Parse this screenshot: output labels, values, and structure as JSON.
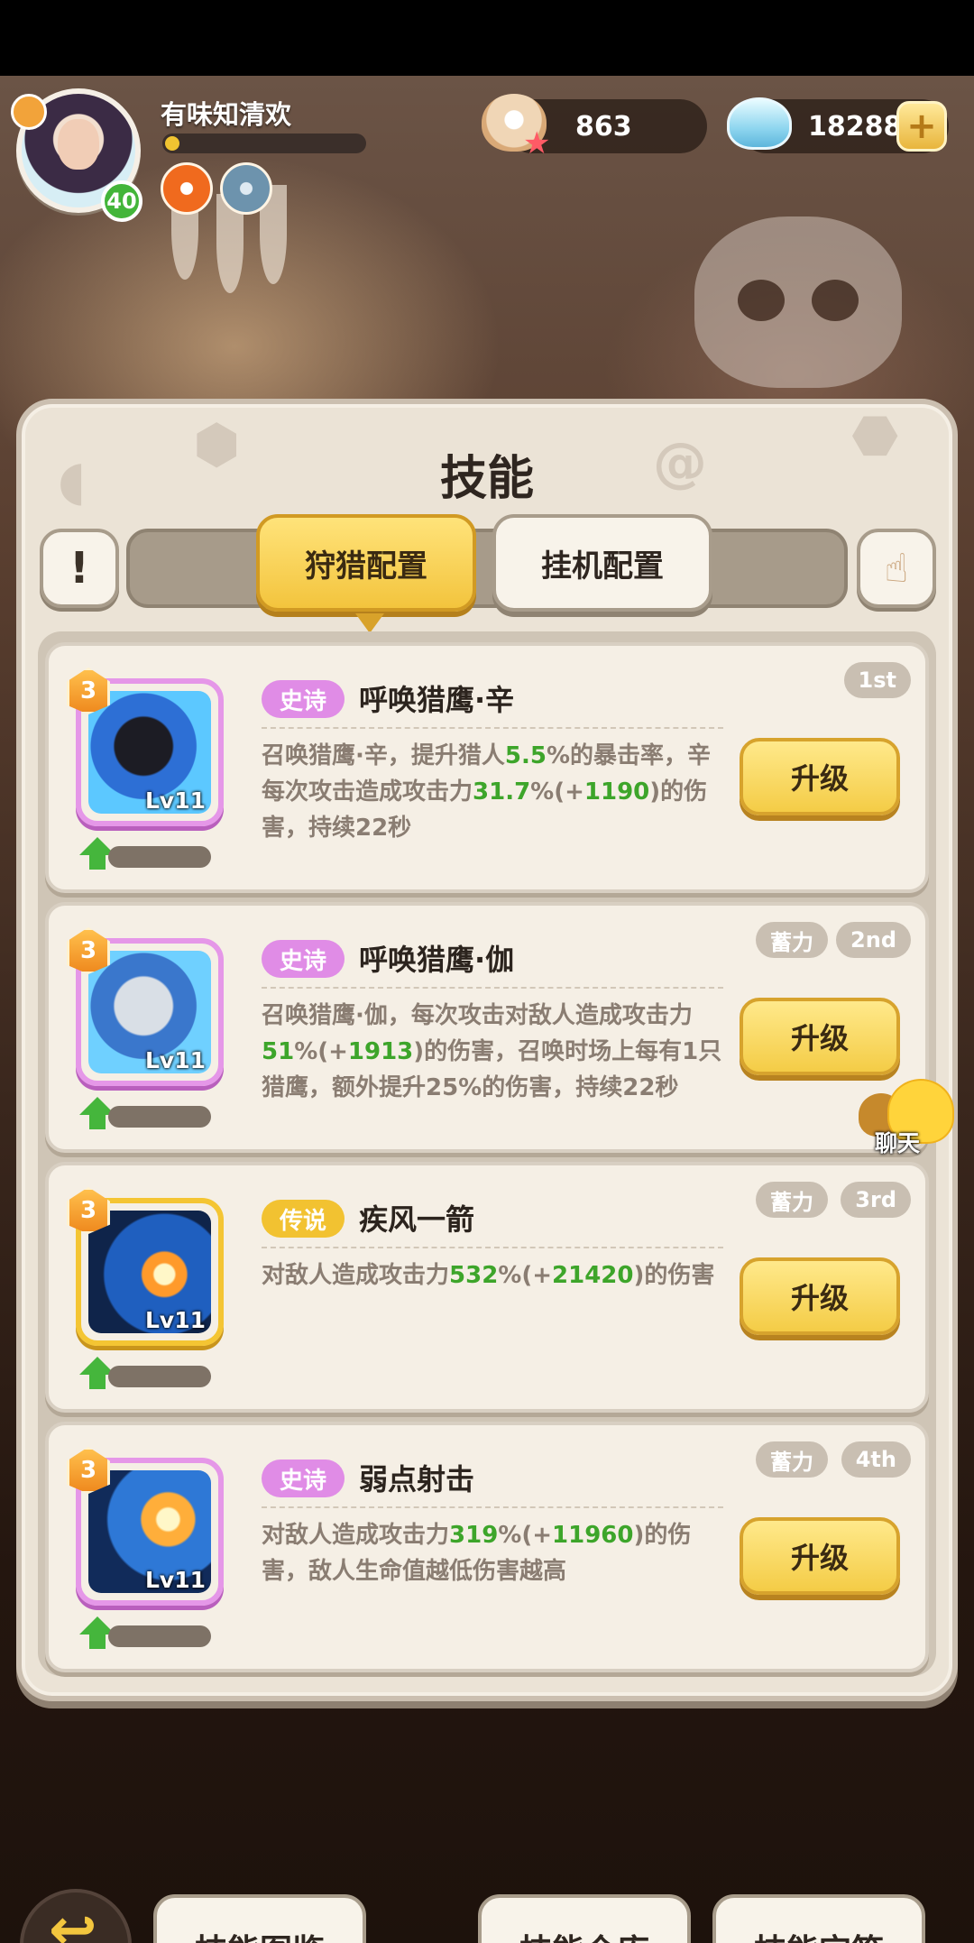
{
  "player": {
    "name": "有味知清欢",
    "level": "40",
    "exp_fraction": 0.06
  },
  "resources": {
    "pearl": "863",
    "diamond": "18288",
    "plus": "+"
  },
  "panel": {
    "title": "技能"
  },
  "tabs": {
    "hunt": "狩猎配置",
    "idle": "挂机配置",
    "info": "!"
  },
  "skills": [
    {
      "stars": "3",
      "lv": "Lv11",
      "rarity": "史诗",
      "name": "呼唤猎鹰·辛",
      "desc": [
        {
          "t": "召唤猎鹰·辛，提升猎人",
          "hl": false
        },
        {
          "t": "5.5",
          "hl": true
        },
        {
          "t": "%的暴击率，辛每次攻击造成攻击力",
          "hl": false
        },
        {
          "t": "31.7",
          "hl": true
        },
        {
          "t": "%(+",
          "hl": false
        },
        {
          "t": "1190",
          "hl": true
        },
        {
          "t": ")的伤害，持续22秒",
          "hl": false
        }
      ],
      "tags": [
        "1st"
      ],
      "upgrade": "升级"
    },
    {
      "stars": "3",
      "lv": "Lv11",
      "rarity": "史诗",
      "name": "呼唤猎鹰·伽",
      "desc": [
        {
          "t": "召唤猎鹰·伽，每次攻击对敌人造成攻击力",
          "hl": false
        },
        {
          "t": "51",
          "hl": true
        },
        {
          "t": "%(+",
          "hl": false
        },
        {
          "t": "1913",
          "hl": true
        },
        {
          "t": ")的伤害，召唤时场上每有1只猎鹰，额外提升25%的伤害，持续22秒",
          "hl": false
        }
      ],
      "tags": [
        "蓄力",
        "2nd"
      ],
      "upgrade": "升级"
    },
    {
      "stars": "3",
      "lv": "Lv11",
      "rarity": "传说",
      "name": "疾风一箭",
      "desc": [
        {
          "t": "对敌人造成攻击力",
          "hl": false
        },
        {
          "t": "532",
          "hl": true
        },
        {
          "t": "%(+",
          "hl": false
        },
        {
          "t": "21420",
          "hl": true
        },
        {
          "t": ")的伤害",
          "hl": false
        }
      ],
      "tags": [
        "蓄力",
        "3rd"
      ],
      "upgrade": "升级"
    },
    {
      "stars": "3",
      "lv": "Lv11",
      "rarity": "史诗",
      "name": "弱点射击",
      "desc": [
        {
          "t": "对敌人造成攻击力",
          "hl": false
        },
        {
          "t": "319",
          "hl": true
        },
        {
          "t": "%(+",
          "hl": false
        },
        {
          "t": "11960",
          "hl": true
        },
        {
          "t": ")的伤害，敌人生命值越低伤害越高",
          "hl": false
        }
      ],
      "tags": [
        "蓄力",
        "4th"
      ],
      "upgrade": "升级"
    }
  ],
  "chat": {
    "label": "聊天"
  },
  "bottom_nav": [
    "技能图鉴",
    "技能仓库",
    "技能宝箱"
  ]
}
